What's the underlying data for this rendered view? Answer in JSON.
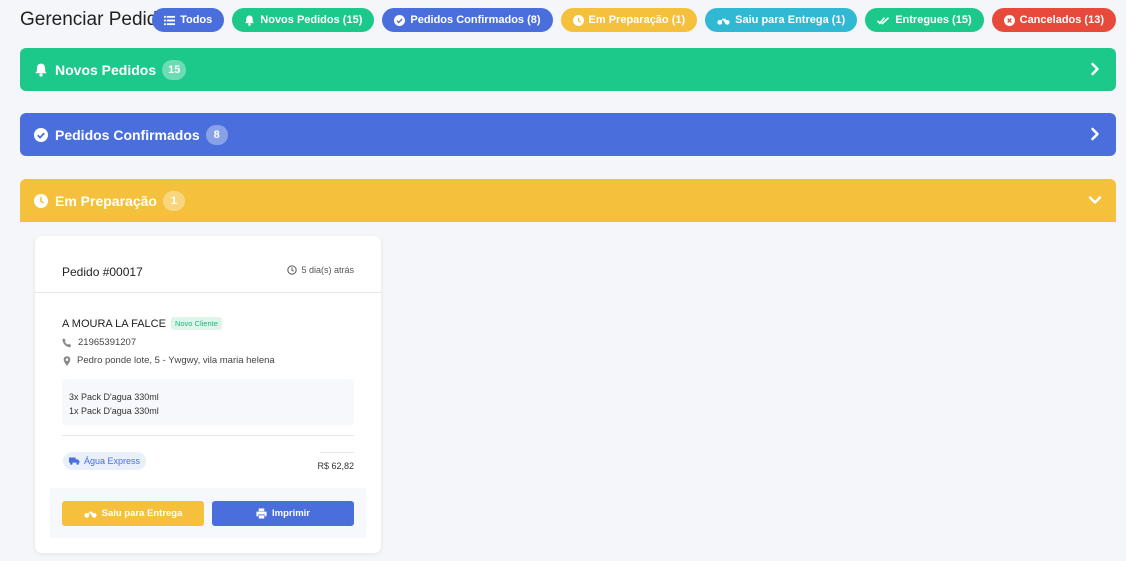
{
  "page": {
    "title": "Gerenciar Pedidos"
  },
  "filters": [
    {
      "label": "Todos",
      "icon": "list-icon",
      "color": "#4a6fdc"
    },
    {
      "label": "Novos Pedidos (15)",
      "icon": "bell-icon",
      "color": "#1cc98a"
    },
    {
      "label": "Pedidos Confirmados (8)",
      "icon": "check-circle-icon",
      "color": "#4a6fdc"
    },
    {
      "label": "Em Preparação (1)",
      "icon": "clock-icon",
      "color": "#f5c13c"
    },
    {
      "label": "Saiu para Entrega (1)",
      "icon": "motorcycle-icon",
      "color": "#31b9d4"
    },
    {
      "label": "Entregues (15)",
      "icon": "double-check-icon",
      "color": "#1cc98a"
    },
    {
      "label": "Cancelados (13)",
      "icon": "x-circle-icon",
      "color": "#e74a3b"
    }
  ],
  "sections": [
    {
      "title": "Novos Pedidos",
      "count": "15",
      "icon": "bell-icon",
      "color": "#1cc98a",
      "expanded": false
    },
    {
      "title": "Pedidos Confirmados",
      "count": "8",
      "icon": "check-circle-icon",
      "color": "#4a6fdc",
      "expanded": false
    },
    {
      "title": "Em Preparação",
      "count": "1",
      "icon": "clock-icon",
      "color": "#f5c13c",
      "expanded": true
    }
  ],
  "order": {
    "number": "Pedido #00017",
    "time": "5 dia(s) atrás",
    "customer": "A MOURA LA FALCE",
    "badge": "Novo Cliente",
    "phone": "21965391207",
    "address": "Pedro ponde lote, 5 - Ywgwy, vila maria helena",
    "items": [
      "3x Pack D'agua 330ml",
      "1x Pack D'agua 330ml"
    ],
    "store": "Água Express",
    "total": "R$ 62,82",
    "actions": {
      "out_for_delivery": "Saiu para Entrega",
      "print": "Imprimir"
    }
  }
}
